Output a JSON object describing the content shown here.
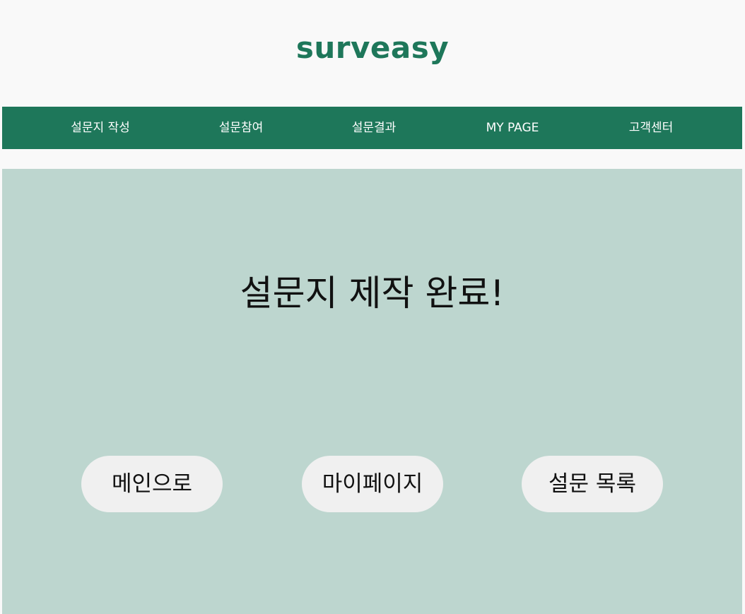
{
  "header": {
    "logo": "surveasy"
  },
  "nav": {
    "items": [
      {
        "label": "설문지 작성"
      },
      {
        "label": "설문참여"
      },
      {
        "label": "설문결과"
      },
      {
        "label": "MY PAGE"
      },
      {
        "label": "고객센터"
      }
    ]
  },
  "main": {
    "title": "설문지 제작 완료!",
    "buttons": [
      {
        "label": "메인으로"
      },
      {
        "label": "마이페이지"
      },
      {
        "label": "설문 목록"
      }
    ]
  },
  "colors": {
    "brand_green": "#1e775a",
    "panel_bg": "#bdd6cf",
    "button_bg": "#f0f0f0",
    "page_bg": "#f9f9f9"
  }
}
